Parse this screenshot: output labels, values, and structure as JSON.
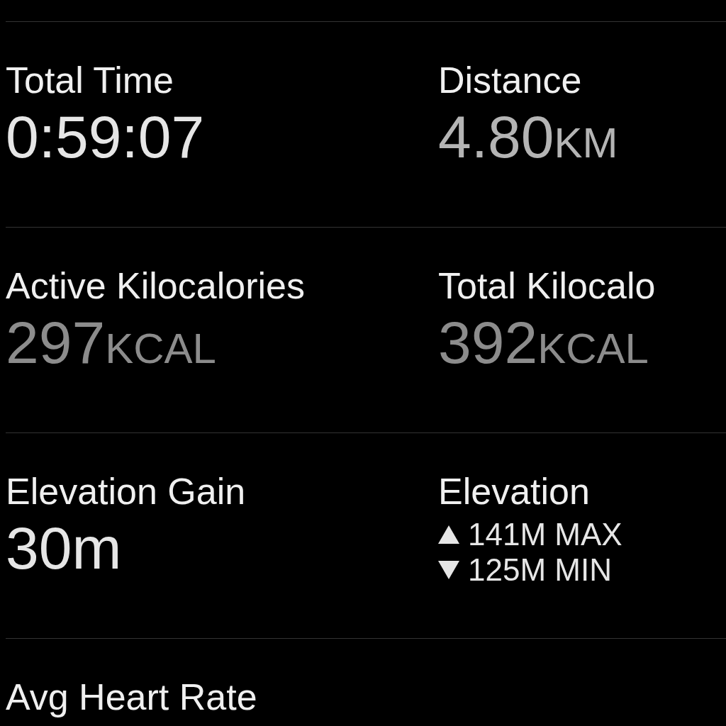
{
  "rows": [
    {
      "cells": [
        {
          "kind": "value",
          "label": "Total Time",
          "value": "0:59:07",
          "color": "#e6e6e6"
        },
        {
          "kind": "value",
          "label": "Distance",
          "value": "4.80",
          "unit": "KM",
          "color": "#b4b4b4"
        }
      ]
    },
    {
      "cells": [
        {
          "kind": "value",
          "label": "Active Kilocalories",
          "value": "297",
          "unit": "KCAL",
          "color": "#8c8c8c"
        },
        {
          "kind": "value",
          "label": "Total Kilocalo",
          "value": "392",
          "unit": "KCAL",
          "color": "#8c8c8c"
        }
      ]
    },
    {
      "cells": [
        {
          "kind": "value",
          "label": "Elevation Gain",
          "value": "30m",
          "color": "#e6e6e6"
        },
        {
          "kind": "range",
          "label": "Elevation",
          "max": "141M MAX",
          "min": "125M MIN",
          "color": "#e6e6e6"
        }
      ]
    },
    {
      "cells": [
        {
          "kind": "label",
          "label": "Avg Heart Rate"
        }
      ]
    }
  ]
}
